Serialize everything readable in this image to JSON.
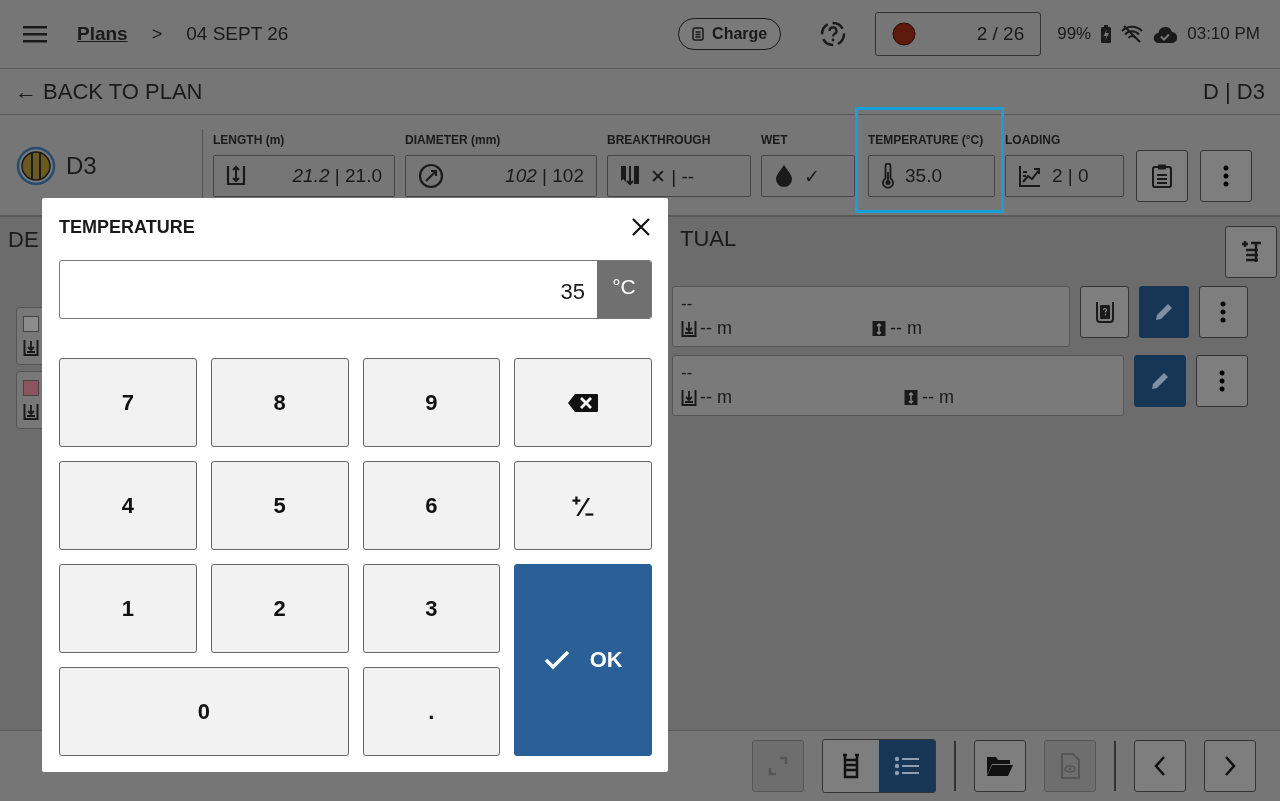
{
  "top_bar": {
    "breadcrumb": [
      {
        "label": "Plans",
        "link": true
      },
      {
        "label": "04 SEPT 26",
        "link": false
      }
    ],
    "separator": ">",
    "charge_button": "Charge",
    "counter": "2 / 26",
    "battery": "99%",
    "time": "03:10 PM"
  },
  "back_bar": {
    "back": "← BACK TO PLAN",
    "location": "D | D3"
  },
  "hole": {
    "name": "D3"
  },
  "fields": [
    {
      "kind": "length",
      "label": "LENGTH (m)",
      "value": "*21.2* | 21.0",
      "selected": false
    },
    {
      "kind": "diameter",
      "label": "DIAMETER (mm)",
      "value": "*102* | 102",
      "selected": false
    },
    {
      "kind": "breakthrough",
      "label": "BREAKTHROUGH",
      "value": "✕  |  --",
      "selected": false
    },
    {
      "kind": "wet",
      "label": "WET",
      "value": "✓",
      "selected": false
    },
    {
      "kind": "temperature",
      "label": "TEMPERATURE (°C)",
      "value": "35.0",
      "selected": true
    },
    {
      "kind": "loading",
      "label": "LOADING",
      "value": "2 | 0",
      "selected": false
    }
  ],
  "columns": {
    "left": "DE",
    "right": "TUAL"
  },
  "left_rows": [
    {
      "color": "#8c8c8c"
    },
    {
      "color": "#8a5560"
    }
  ],
  "right_rows": [
    {
      "value": "--",
      "depth": "-- m",
      "length": "-- m",
      "actions": [
        {
          "kind": "query"
        },
        {
          "kind": "edit"
        },
        {
          "kind": "more"
        }
      ]
    },
    {
      "value": "--",
      "depth": "-- m",
      "length": "-- m",
      "actions": [
        {
          "kind": "edit"
        },
        {
          "kind": "more"
        }
      ]
    }
  ],
  "bottom_bar": {
    "expand_disabled": true,
    "views": [
      {
        "kind": "ladder",
        "selected": false
      },
      {
        "kind": "list",
        "selected": true
      }
    ],
    "preview_disabled": true
  },
  "dialog": {
    "title": "TEMPERATURE",
    "value": "35",
    "unit": "°C",
    "keys": [
      {
        "kind": "digit",
        "label": "7"
      },
      {
        "kind": "digit",
        "label": "8"
      },
      {
        "kind": "digit",
        "label": "9"
      },
      {
        "kind": "backspace"
      },
      {
        "kind": "digit",
        "label": "4"
      },
      {
        "kind": "digit",
        "label": "5"
      },
      {
        "kind": "digit",
        "label": "6"
      },
      {
        "kind": "sign",
        "label": "⁺∕₋"
      },
      {
        "kind": "digit",
        "label": "1"
      },
      {
        "kind": "digit",
        "label": "2"
      },
      {
        "kind": "digit",
        "label": "3"
      },
      {
        "kind": "ok",
        "label": "OK"
      },
      {
        "kind": "zero",
        "label": "0"
      },
      {
        "kind": "digit",
        "label": "."
      }
    ]
  }
}
